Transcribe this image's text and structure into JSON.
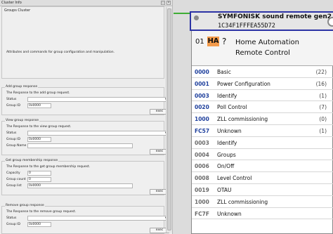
{
  "dock": {
    "title": "Cluster Info",
    "cluster_title": "Groups Cluster",
    "cluster_desc": "Attributes and commands for group configuration and manipulation."
  },
  "groups": [
    {
      "title": "Add group response",
      "desc": "The Response to the add group request.",
      "fields": [
        {
          "label": "Status",
          "kind": "combo",
          "value": ""
        },
        {
          "label": "Group ID",
          "kind": "text",
          "value": "0x0000"
        }
      ],
      "exec": "exec"
    },
    {
      "title": "View group response",
      "desc": "The Response to the view group request.",
      "fields": [
        {
          "label": "Status",
          "kind": "combo",
          "value": ""
        },
        {
          "label": "Group ID",
          "kind": "text",
          "value": "0x0000"
        },
        {
          "label": "Group Name",
          "kind": "text",
          "value": ""
        }
      ],
      "exec": "exec"
    },
    {
      "title": "Get group membership response",
      "desc": "The Response to the get group membership request.",
      "fields": [
        {
          "label": "Capacity",
          "kind": "text",
          "value": "0"
        },
        {
          "label": "Group count",
          "kind": "text",
          "value": "0"
        },
        {
          "label": "Group list",
          "kind": "text",
          "value": "0x0000"
        }
      ],
      "exec": "exec"
    },
    {
      "title": "Remove group response",
      "desc": "The Response to the remove group request.",
      "fields": [
        {
          "label": "Status",
          "kind": "combo",
          "value": ""
        },
        {
          "label": "Group ID",
          "kind": "text",
          "value": "0x0000"
        }
      ],
      "exec": "exec"
    }
  ],
  "node": {
    "name": "SYMFONISK sound remote gen2",
    "ext_addr": "1C34F1FFFEA55D72",
    "endpoint": "01",
    "profile": "HA",
    "device_type": "?",
    "profile_name_line1": "Home Automation",
    "profile_name_line2": "Remote Control",
    "clusters": [
      {
        "id": "0000",
        "name": "Basic",
        "count": "(22)",
        "server": true
      },
      {
        "id": "0001",
        "name": "Power Configuration",
        "count": "(16)",
        "server": true
      },
      {
        "id": "0003",
        "name": "Identify",
        "count": "(1)",
        "server": true
      },
      {
        "id": "0020",
        "name": "Poll Control",
        "count": "(7)",
        "server": true
      },
      {
        "id": "1000",
        "name": "ZLL commissioning",
        "count": "(0)",
        "server": true
      },
      {
        "id": "FC57",
        "name": "Unknown",
        "count": "(1)",
        "server": true
      },
      {
        "id": "0003",
        "name": "Identify",
        "count": "",
        "server": false
      },
      {
        "id": "0004",
        "name": "Groups",
        "count": "",
        "server": false
      },
      {
        "id": "0006",
        "name": "On/Off",
        "count": "",
        "server": false
      },
      {
        "id": "0008",
        "name": "Level Control",
        "count": "",
        "server": false
      },
      {
        "id": "0019",
        "name": "OTAU",
        "count": "",
        "server": false
      },
      {
        "id": "1000",
        "name": "ZLL commissioning",
        "count": "",
        "server": false
      },
      {
        "id": "FC7F",
        "name": "Unknown",
        "count": "",
        "server": false
      }
    ]
  },
  "colors": {
    "node_border": "#2c33a5",
    "server_cluster": "#1e3f9c",
    "client_cluster": "#6b6b6b",
    "profile_badge": "#f39a4a",
    "connector": "#3fae35"
  }
}
